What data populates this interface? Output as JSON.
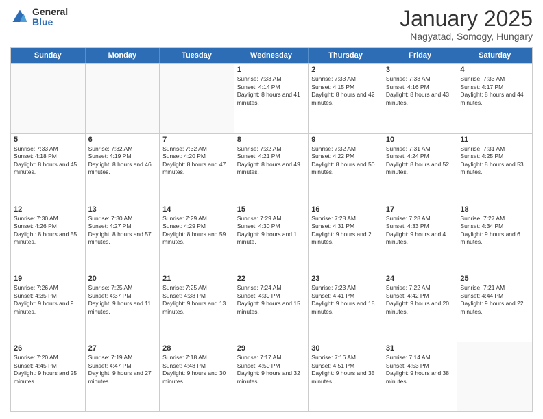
{
  "logo": {
    "general": "General",
    "blue": "Blue"
  },
  "title": {
    "month": "January 2025",
    "location": "Nagyatad, Somogy, Hungary"
  },
  "weekdays": [
    "Sunday",
    "Monday",
    "Tuesday",
    "Wednesday",
    "Thursday",
    "Friday",
    "Saturday"
  ],
  "weeks": [
    [
      {
        "day": "",
        "info": ""
      },
      {
        "day": "",
        "info": ""
      },
      {
        "day": "",
        "info": ""
      },
      {
        "day": "1",
        "info": "Sunrise: 7:33 AM\nSunset: 4:14 PM\nDaylight: 8 hours and 41 minutes."
      },
      {
        "day": "2",
        "info": "Sunrise: 7:33 AM\nSunset: 4:15 PM\nDaylight: 8 hours and 42 minutes."
      },
      {
        "day": "3",
        "info": "Sunrise: 7:33 AM\nSunset: 4:16 PM\nDaylight: 8 hours and 43 minutes."
      },
      {
        "day": "4",
        "info": "Sunrise: 7:33 AM\nSunset: 4:17 PM\nDaylight: 8 hours and 44 minutes."
      }
    ],
    [
      {
        "day": "5",
        "info": "Sunrise: 7:33 AM\nSunset: 4:18 PM\nDaylight: 8 hours and 45 minutes."
      },
      {
        "day": "6",
        "info": "Sunrise: 7:32 AM\nSunset: 4:19 PM\nDaylight: 8 hours and 46 minutes."
      },
      {
        "day": "7",
        "info": "Sunrise: 7:32 AM\nSunset: 4:20 PM\nDaylight: 8 hours and 47 minutes."
      },
      {
        "day": "8",
        "info": "Sunrise: 7:32 AM\nSunset: 4:21 PM\nDaylight: 8 hours and 49 minutes."
      },
      {
        "day": "9",
        "info": "Sunrise: 7:32 AM\nSunset: 4:22 PM\nDaylight: 8 hours and 50 minutes."
      },
      {
        "day": "10",
        "info": "Sunrise: 7:31 AM\nSunset: 4:24 PM\nDaylight: 8 hours and 52 minutes."
      },
      {
        "day": "11",
        "info": "Sunrise: 7:31 AM\nSunset: 4:25 PM\nDaylight: 8 hours and 53 minutes."
      }
    ],
    [
      {
        "day": "12",
        "info": "Sunrise: 7:30 AM\nSunset: 4:26 PM\nDaylight: 8 hours and 55 minutes."
      },
      {
        "day": "13",
        "info": "Sunrise: 7:30 AM\nSunset: 4:27 PM\nDaylight: 8 hours and 57 minutes."
      },
      {
        "day": "14",
        "info": "Sunrise: 7:29 AM\nSunset: 4:29 PM\nDaylight: 8 hours and 59 minutes."
      },
      {
        "day": "15",
        "info": "Sunrise: 7:29 AM\nSunset: 4:30 PM\nDaylight: 9 hours and 1 minute."
      },
      {
        "day": "16",
        "info": "Sunrise: 7:28 AM\nSunset: 4:31 PM\nDaylight: 9 hours and 2 minutes."
      },
      {
        "day": "17",
        "info": "Sunrise: 7:28 AM\nSunset: 4:33 PM\nDaylight: 9 hours and 4 minutes."
      },
      {
        "day": "18",
        "info": "Sunrise: 7:27 AM\nSunset: 4:34 PM\nDaylight: 9 hours and 6 minutes."
      }
    ],
    [
      {
        "day": "19",
        "info": "Sunrise: 7:26 AM\nSunset: 4:35 PM\nDaylight: 9 hours and 9 minutes."
      },
      {
        "day": "20",
        "info": "Sunrise: 7:25 AM\nSunset: 4:37 PM\nDaylight: 9 hours and 11 minutes."
      },
      {
        "day": "21",
        "info": "Sunrise: 7:25 AM\nSunset: 4:38 PM\nDaylight: 9 hours and 13 minutes."
      },
      {
        "day": "22",
        "info": "Sunrise: 7:24 AM\nSunset: 4:39 PM\nDaylight: 9 hours and 15 minutes."
      },
      {
        "day": "23",
        "info": "Sunrise: 7:23 AM\nSunset: 4:41 PM\nDaylight: 9 hours and 18 minutes."
      },
      {
        "day": "24",
        "info": "Sunrise: 7:22 AM\nSunset: 4:42 PM\nDaylight: 9 hours and 20 minutes."
      },
      {
        "day": "25",
        "info": "Sunrise: 7:21 AM\nSunset: 4:44 PM\nDaylight: 9 hours and 22 minutes."
      }
    ],
    [
      {
        "day": "26",
        "info": "Sunrise: 7:20 AM\nSunset: 4:45 PM\nDaylight: 9 hours and 25 minutes."
      },
      {
        "day": "27",
        "info": "Sunrise: 7:19 AM\nSunset: 4:47 PM\nDaylight: 9 hours and 27 minutes."
      },
      {
        "day": "28",
        "info": "Sunrise: 7:18 AM\nSunset: 4:48 PM\nDaylight: 9 hours and 30 minutes."
      },
      {
        "day": "29",
        "info": "Sunrise: 7:17 AM\nSunset: 4:50 PM\nDaylight: 9 hours and 32 minutes."
      },
      {
        "day": "30",
        "info": "Sunrise: 7:16 AM\nSunset: 4:51 PM\nDaylight: 9 hours and 35 minutes."
      },
      {
        "day": "31",
        "info": "Sunrise: 7:14 AM\nSunset: 4:53 PM\nDaylight: 9 hours and 38 minutes."
      },
      {
        "day": "",
        "info": ""
      }
    ]
  ]
}
